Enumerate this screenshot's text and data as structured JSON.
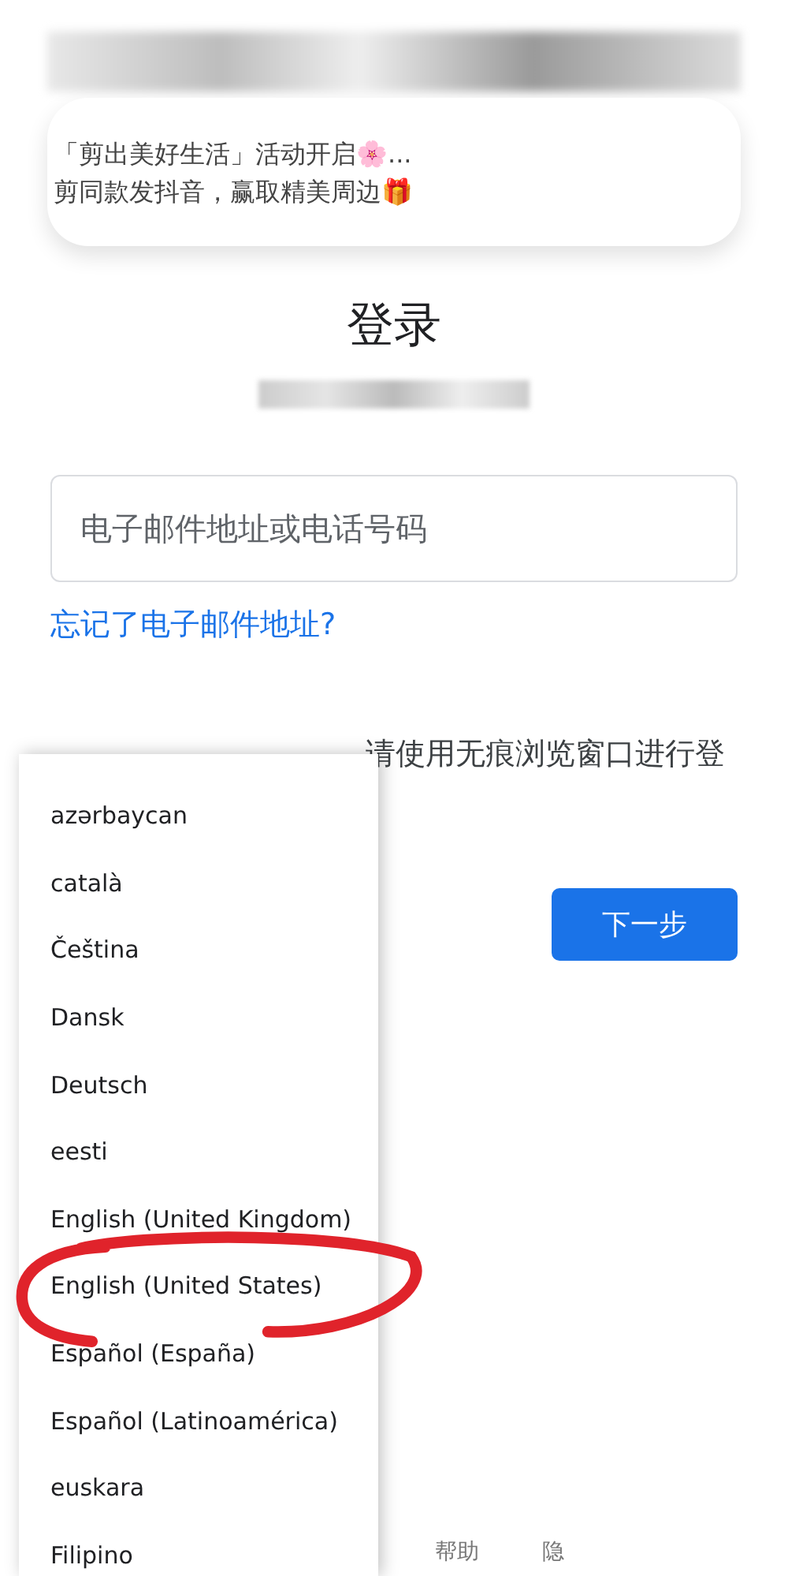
{
  "notification": {
    "lines": [
      "「剪出美好生活」活动开启🌸...",
      "剪同款发抖音，赢取精美周边🎁"
    ]
  },
  "title": "登录",
  "email_field": {
    "placeholder": "电子邮件地址或电话号码"
  },
  "forgot_link": "忘记了电子邮件地址?",
  "guest_notice": "请使用无痕浏览窗口进行登",
  "next_button": "下一步",
  "language_menu": {
    "items": [
      {
        "label": "azərbaycan"
      },
      {
        "label": "català"
      },
      {
        "label": "Čeština"
      },
      {
        "label": "Dansk"
      },
      {
        "label": "Deutsch"
      },
      {
        "label": "eesti"
      },
      {
        "label": "English (United Kingdom)"
      },
      {
        "label": "English (United States)",
        "circled": true
      },
      {
        "label": "Español (España)"
      },
      {
        "label": "Español (Latinoamérica)"
      },
      {
        "label": "euskara"
      },
      {
        "label": "Filipino"
      }
    ]
  },
  "footer": [
    "帮助",
    "隐"
  ]
}
